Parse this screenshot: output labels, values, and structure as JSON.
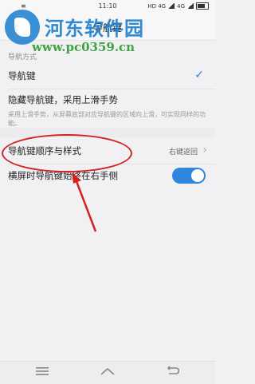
{
  "status_bar": {
    "time": "11:10",
    "left_indicator": "≡",
    "network": "HD 4G",
    "network2": "4G"
  },
  "title_bar": {
    "title": "导航键"
  },
  "watermark": {
    "title": "河东软件园",
    "url": "www.pc0359.cn"
  },
  "settings": {
    "section_label": "导航方式",
    "options": [
      {
        "label": "导航键",
        "selected": true
      },
      {
        "label": "隐藏导航键，采用上滑手势",
        "selected": false
      }
    ],
    "description": "采用上滑手势，从屏幕底部对应导航键的区域向上滑，可实现同样的功能。",
    "order_style": {
      "label": "导航键顺序与样式",
      "value": "右键返回"
    },
    "landscape": {
      "label": "横屏时导航键始终在右手侧",
      "enabled": true
    }
  },
  "colors": {
    "accent": "#2e86de",
    "annotation": "#d32020"
  },
  "nav_bar": {
    "buttons": [
      "menu-icon",
      "home-icon",
      "back-icon"
    ]
  }
}
